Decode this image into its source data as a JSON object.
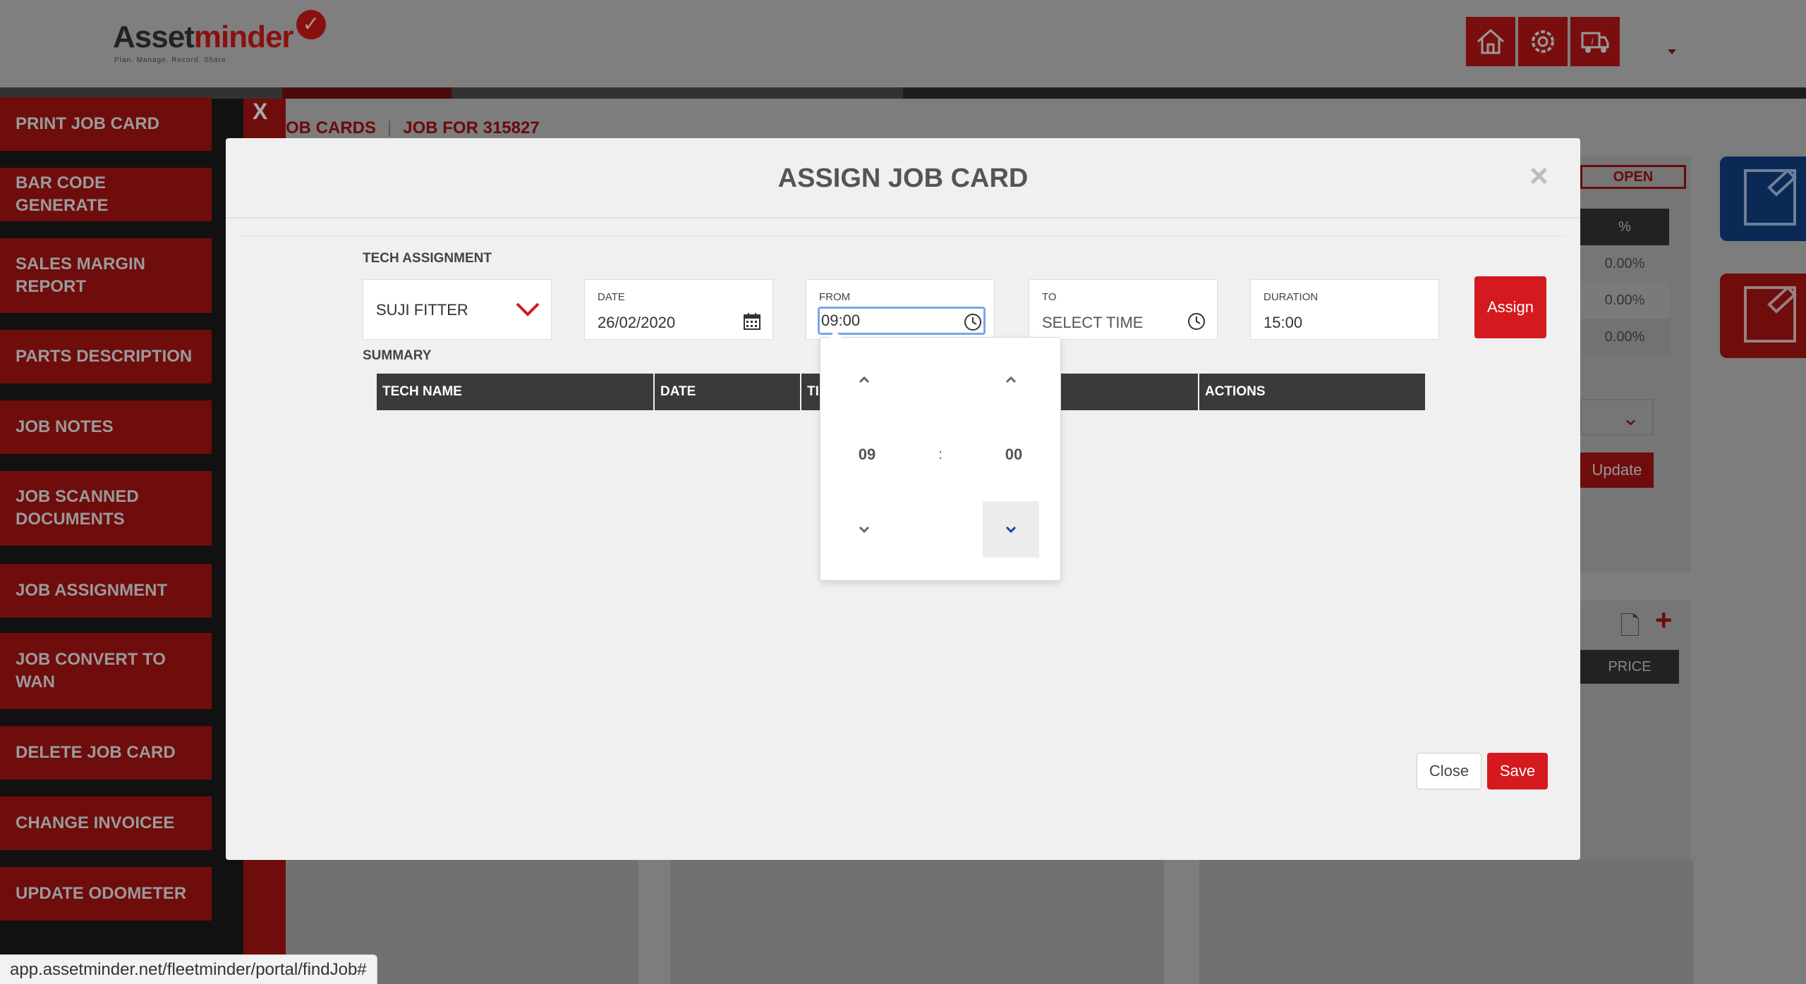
{
  "header": {
    "logo_text_part1": "Asset",
    "logo_text_part2": "minder",
    "logo_tagline": "Plan. Manage. Record. Share.",
    "icons": [
      "home-icon",
      "gear-wrench-icon",
      "truck-info-icon"
    ]
  },
  "sidebar": {
    "close_label": "X",
    "items": [
      {
        "label": "PRINT JOB CARD"
      },
      {
        "label": "BAR CODE GENERATE"
      },
      {
        "label": "SALES MARGIN REPORT"
      },
      {
        "label": "PARTS DESCRIPTION"
      },
      {
        "label": "JOB NOTES"
      },
      {
        "label": "JOB SCANNED DOCUMENTS"
      },
      {
        "label": "JOB ASSIGNMENT"
      },
      {
        "label": "JOB CONVERT TO WAN"
      },
      {
        "label": "DELETE JOB CARD"
      },
      {
        "label": "CHANGE INVOICEE"
      },
      {
        "label": "UPDATE ODOMETER"
      }
    ]
  },
  "breadcrumb": {
    "item1": "OB CARDS",
    "separator": "|",
    "item2": "JOB FOR 315827"
  },
  "background": {
    "status_badge": "OPEN",
    "pct_header": "%",
    "pct_values": [
      "0.00%",
      "0.00%",
      "0.00%"
    ],
    "update_label": "Update",
    "price_header": "PRICE"
  },
  "modal": {
    "title": "ASSIGN JOB CARD",
    "close_icon": "×",
    "tech_assignment_label": "TECH ASSIGNMENT",
    "tech_select_value": "SUJI FITTER",
    "date_label": "DATE",
    "date_value": "26/02/2020",
    "from_label": "FROM",
    "from_value": "09:00",
    "to_label": "TO",
    "to_placeholder": "SELECT TIME",
    "duration_label": "DURATION",
    "duration_value": "15:00",
    "assign_button": "Assign",
    "summary_label": "SUMMARY",
    "summary_columns": [
      "TECH NAME",
      "DATE",
      "TI",
      "",
      "ACTIONS"
    ],
    "close_button": "Close",
    "save_button": "Save"
  },
  "timepicker": {
    "hour": "09",
    "separator": ":",
    "minute": "00"
  },
  "statusbar": {
    "url": "app.assetminder.net/fleetminder/portal/findJob#"
  },
  "colors": {
    "brand_red": "#d4191f",
    "dark_red": "#6f0c0c",
    "modal_bg": "#f0f0f0",
    "table_header": "#3a3a3a",
    "focus_blue": "#7aa6e8"
  }
}
